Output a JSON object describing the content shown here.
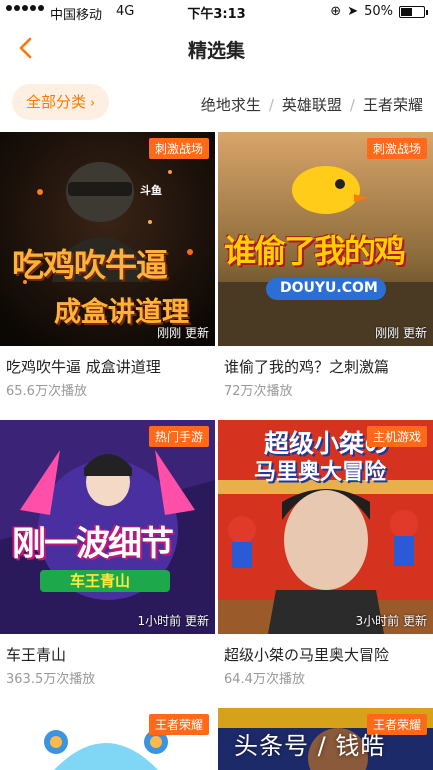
{
  "status_bar": {
    "carrier": "中国移动",
    "network": "4G",
    "time": "下午3:13",
    "battery": "50%",
    "battery_level": 0.5
  },
  "nav": {
    "title": "精选集"
  },
  "categories": {
    "all_label": "全部分类",
    "items": [
      "绝地求生",
      "英雄联盟",
      "王者荣耀"
    ]
  },
  "cards": [
    {
      "tag": "刺激战场",
      "updated": "刚刚 更新",
      "title": "吃鸡吹牛逼 成盒讲道理",
      "plays": "65.6万次播放",
      "thumb_text_1": "吃鸡吹牛逼",
      "thumb_text_2": "成盒讲道理",
      "thumb_logo": "斗鱼"
    },
    {
      "tag": "刺激战场",
      "updated": "刚刚 更新",
      "title": "谁偷了我的鸡？之刺激篇",
      "plays": "72万次播放",
      "thumb_text_1": "谁偷了我的鸡",
      "thumb_text_2": "DOUYU.COM"
    },
    {
      "tag": "热门手游",
      "updated": "1小时前 更新",
      "title": "车王青山",
      "plays": "363.5万次播放",
      "thumb_text_1": "刚一波细节",
      "thumb_text_2": "车王青山"
    },
    {
      "tag": "主机游戏",
      "updated": "3小时前 更新",
      "title": "超级小桀の马里奥大冒险",
      "plays": "64.4万次播放",
      "thumb_text_1": "超级小桀の",
      "thumb_text_2": "马里奥大冒险"
    },
    {
      "tag": "王者荣耀"
    },
    {
      "tag": "王者荣耀"
    }
  ],
  "watermark": "头条号 / 钱皓"
}
